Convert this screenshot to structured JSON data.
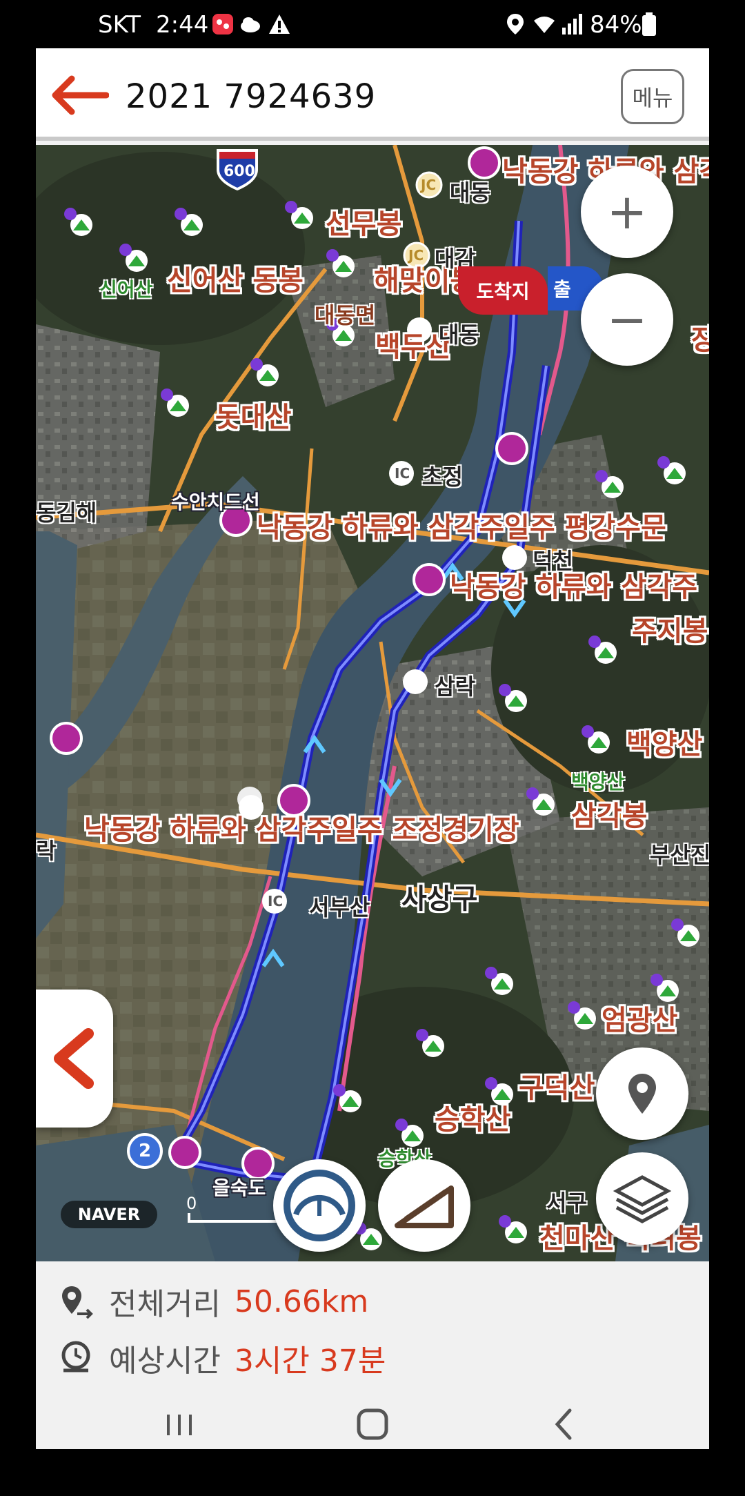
{
  "status_bar": {
    "carrier": "SKT",
    "time": "2:44",
    "battery": "84%",
    "notification_icons": [
      "app-notification-icon",
      "cloud-icon",
      "warning-icon"
    ],
    "system_icons": [
      "location-icon",
      "wifi-icon",
      "signal-icon",
      "battery-icon"
    ]
  },
  "header": {
    "title": "2021 7924639",
    "menu_label": "메뉴",
    "back_icon": "back-arrow-icon"
  },
  "map": {
    "places": {
      "p1": "낙동강 하류와 삼각",
      "p2": "대동",
      "p3": "선무봉",
      "p4": "신어산 동봉",
      "p5": "신어산",
      "p6": "해맞이봉",
      "p7": "대감",
      "p8": "대동면",
      "p9": "백두산",
      "p10": "돗대산",
      "p11": "초정",
      "p12": "동김해",
      "p13": "수안치드선",
      "p14": "낙동강 하류와 삼각주일주 평강수문",
      "p15": "덕천",
      "p16": "낙동강 하류와 삼각주",
      "p17": "주지봉",
      "p18": "삼락",
      "p19": "백양산",
      "p20": "백양산",
      "p21": "삼각봉",
      "p22": "낙동강 하류와 삼각주일주 조정경기장",
      "p23": "부산진",
      "p24": "서부산",
      "p25": "사상구",
      "p26": "엄광산",
      "p27": "구덕산",
      "p28": "승학산",
      "p29": "서구",
      "p30": "천마산 복려봉",
      "p31": "을숙도",
      "p32": "승학산",
      "p33": "락",
      "p34": "장"
    },
    "highway_shield_600": "600",
    "road_badge_2": "2",
    "arrival_flag": "도착지",
    "departure_flag": "출",
    "jc1": "JC",
    "jc2": "JC",
    "ic1": "IC",
    "ic2": "IC",
    "scale_label": "0",
    "naver_logo": "NAVER",
    "zoom_in": "+",
    "zoom_out": "−",
    "route_color": "#2a2ed6",
    "road_color": "#f0a040"
  },
  "info": {
    "distance_label": "전체거리",
    "distance_value": "50.66km",
    "time_label": "예상시간",
    "time_value": "3시간 37분"
  },
  "nav_bar": {
    "items": [
      "recent-apps-icon",
      "home-icon",
      "back-icon"
    ]
  }
}
